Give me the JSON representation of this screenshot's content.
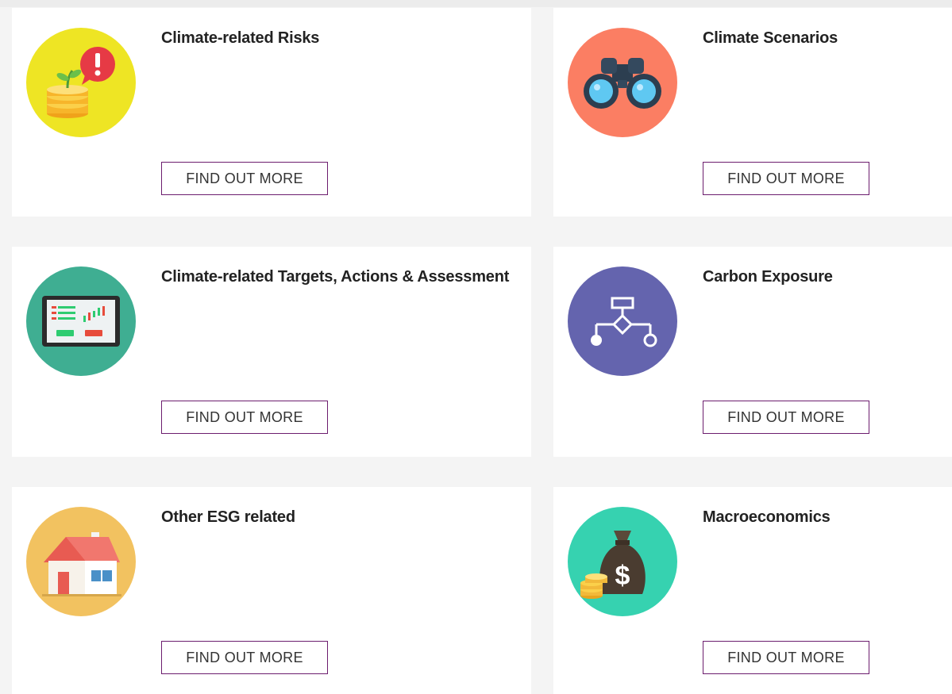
{
  "cards": [
    {
      "title": "Climate-related Risks",
      "button": "FIND OUT MORE",
      "icon": "coins-alert-icon",
      "color": "#eee524"
    },
    {
      "title": "Climate Scenarios",
      "button": "FIND OUT MORE",
      "icon": "binoculars-icon",
      "color": "#fb7e63"
    },
    {
      "title": "Climate-related Targets, Actions & Assessment",
      "button": "FIND OUT MORE",
      "icon": "trading-tablet-icon",
      "color": "#3fae92"
    },
    {
      "title": "Carbon Exposure",
      "button": "FIND OUT MORE",
      "icon": "flowchart-icon",
      "color": "#6464ae"
    },
    {
      "title": "Other ESG related",
      "button": "FIND OUT MORE",
      "icon": "house-icon",
      "color": "#f2c260"
    },
    {
      "title": "Macroeconomics",
      "button": "FIND OUT MORE",
      "icon": "money-bag-icon",
      "color": "#36d2b0"
    }
  ],
  "colors": {
    "button_border": "#6c1d6e",
    "page_background": "#f4f4f4",
    "card_background": "#ffffff"
  }
}
